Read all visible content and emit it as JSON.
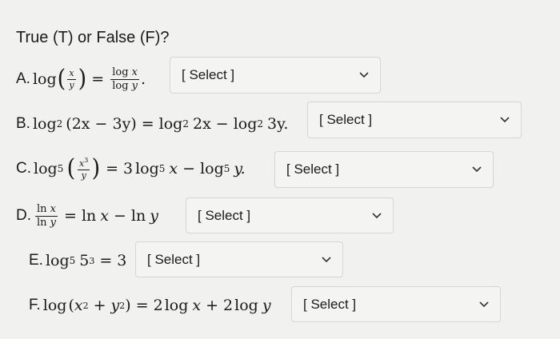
{
  "title": "True (T) or False (F)?",
  "questions": [
    {
      "letter": "A.",
      "selected": "[ Select ]"
    },
    {
      "letter": "B.",
      "selected": "[ Select ]"
    },
    {
      "letter": "C.",
      "selected": "[ Select ]"
    },
    {
      "letter": "D.",
      "selected": "[ Select ]"
    },
    {
      "letter": "E.",
      "selected": "[ Select ]"
    },
    {
      "letter": "F.",
      "selected": "[ Select ]"
    }
  ],
  "math": {
    "log": "log",
    "ln": "ln",
    "eq": "=",
    "minus": "−",
    "plus": "+",
    "x": "x",
    "y": "y",
    "b2": "2",
    "b5": "5",
    "dot": ".",
    "a_lhs_paren_open": "(",
    "a_lhs_paren_close": ")",
    "b_arg": "(2x − 3y)",
    "b_t1": "2x",
    "b_t2": "3y.",
    "c_coef": "3",
    "c_x3": "3",
    "c_end": "y.",
    "e_pow_base": "5",
    "e_pow_exp": "3",
    "e_rhs": "3",
    "f_open": "(",
    "f_close": ")",
    "f_two": "2",
    "f_coef": "2"
  },
  "icons": {
    "dropdown": "chevron-down-icon"
  }
}
